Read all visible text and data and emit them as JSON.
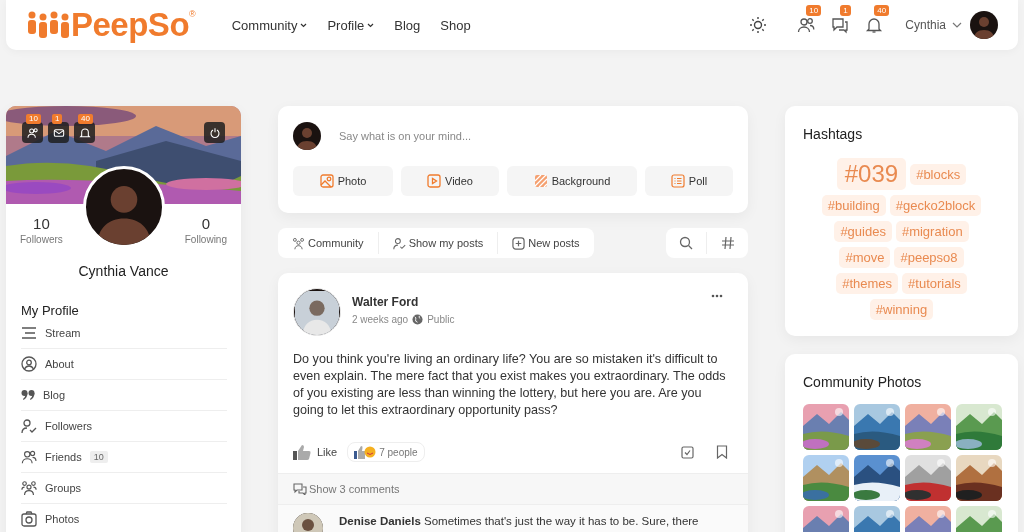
{
  "header": {
    "logo": "PeepSo",
    "logo_mark": "®",
    "nav": [
      {
        "label": "Community",
        "dropdown": true
      },
      {
        "label": "Profile",
        "dropdown": true
      },
      {
        "label": "Blog",
        "dropdown": false
      },
      {
        "label": "Shop",
        "dropdown": false
      }
    ],
    "notifications": [
      {
        "count": "10"
      },
      {
        "count": "1"
      },
      {
        "count": "40"
      }
    ],
    "user": "Cynthia"
  },
  "profile": {
    "badges": [
      {
        "count": "10"
      },
      {
        "count": "1"
      },
      {
        "count": "40"
      }
    ],
    "stats": [
      {
        "value": "10",
        "label": "Followers"
      },
      {
        "value": "0",
        "label": "Following"
      }
    ],
    "name": "Cynthia Vance",
    "menu_title": "My Profile",
    "menu": [
      {
        "label": "Stream"
      },
      {
        "label": "About"
      },
      {
        "label": "Blog"
      },
      {
        "label": "Followers"
      },
      {
        "label": "Friends",
        "count": "10"
      },
      {
        "label": "Groups"
      },
      {
        "label": "Photos"
      }
    ]
  },
  "composer": {
    "placeholder": "Say what is on your mind...",
    "actions": [
      "Photo",
      "Video",
      "Background",
      "Poll"
    ]
  },
  "filters": [
    "Community",
    "Show my posts",
    "New posts"
  ],
  "post": {
    "author": "Walter Ford",
    "time": "2 weeks ago",
    "privacy": "Public",
    "text": "Do you think you're living an ordinary life? You are so mistaken it's difficult to even explain. The mere fact that you exist makes you extraordinary. The odds of you existing are less than winning the lottery, but here you are. Are you going to let this extraordinary opportunity pass?",
    "like": "Like",
    "reactions": "7 people",
    "comments_toggle": "Show 3 comments",
    "comment": {
      "author": "Denise Daniels",
      "text": "Sometimes that's just the way it has to be. Sure, there"
    }
  },
  "hashtags": {
    "title": "Hashtags",
    "tags": [
      {
        "label": "#039",
        "kind": "large"
      },
      {
        "label": "#blocks",
        "kind": "normal"
      },
      {
        "label": "#building",
        "kind": "normal"
      },
      {
        "label": "#gecko2block",
        "kind": "normal"
      },
      {
        "label": "#guides",
        "kind": "normal"
      },
      {
        "label": "#migration",
        "kind": "normal"
      },
      {
        "label": "#move",
        "kind": "normal"
      },
      {
        "label": "#peepso8",
        "kind": "normal"
      },
      {
        "label": "#themes",
        "kind": "normal"
      },
      {
        "label": "#tutorials",
        "kind": "normal"
      },
      {
        "label": "#winning",
        "kind": "normal"
      }
    ]
  },
  "community_photos": {
    "title": "Community Photos"
  }
}
